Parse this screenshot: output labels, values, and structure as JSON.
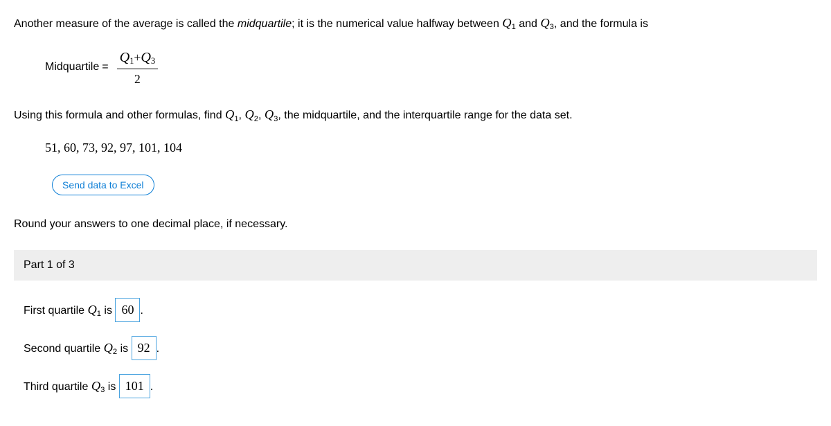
{
  "intro": {
    "prefix": "Another measure of the average is called the ",
    "term": "midquartile",
    "mid1": "; it is the numerical value halfway between ",
    "q1": "Q",
    "q1sub": "1",
    "and1": " and ",
    "q3": "Q",
    "q3sub": "3",
    "suffix": ", and the formula is"
  },
  "formula": {
    "label": "Midquartile",
    "eq": " = ",
    "top_q1": "Q",
    "top_q1sub": "1",
    "top_plus": "+",
    "top_q3": "Q",
    "top_q3sub": "3",
    "bottom": "2"
  },
  "instruction": {
    "prefix": "Using this formula and other formulas, find ",
    "q1": "Q",
    "q1sub": "1",
    "c1": ", ",
    "q2": "Q",
    "q2sub": "2",
    "c2": ", ",
    "q3": "Q",
    "q3sub": "3",
    "suffix": ", the midquartile, and the interquartile range for the data set."
  },
  "data_values": "51, 60, 73, 92, 97, 101, 104",
  "excel_button": "Send data to Excel",
  "round_note": "Round your answers to one decimal place, if necessary.",
  "part_header": "Part 1 of 3",
  "answers": {
    "q1": {
      "label_prefix": "First quartile ",
      "var": "Q",
      "sub": "1",
      "label_suffix": " is ",
      "value": "60",
      "tail": "."
    },
    "q2": {
      "label_prefix": "Second quartile ",
      "var": "Q",
      "sub": "2",
      "label_suffix": " is ",
      "value": "92",
      "tail": "."
    },
    "q3": {
      "label_prefix": "Third quartile ",
      "var": "Q",
      "sub": "3",
      "label_suffix": " is ",
      "value": "101",
      "tail": "."
    }
  }
}
